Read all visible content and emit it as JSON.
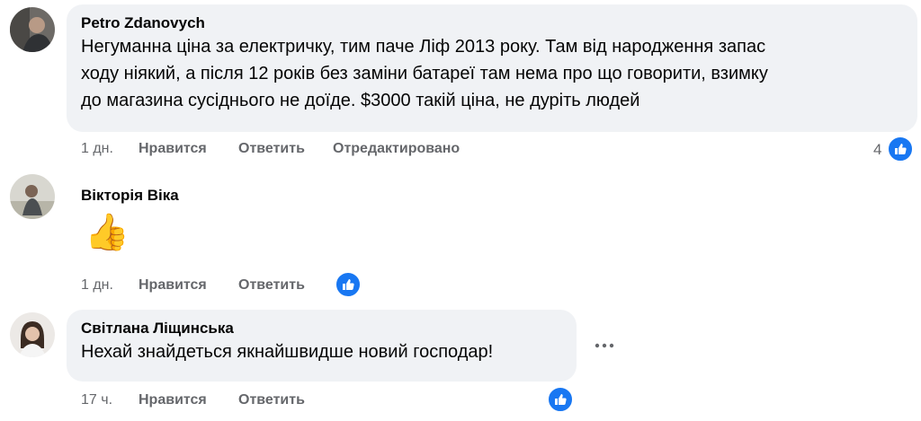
{
  "comments": [
    {
      "author": "Petro Zdanovych",
      "lines": [
        "Негуманна ціна за електричку, тим паче Ліф 2013 року. Там від народження запас",
        "ходу ніякий, а після 12 років без заміни батареї там нема про що говорити, взимку",
        "до магазина сусіднього не доїде. $3000 такій ціна, не дуріть людей"
      ],
      "time": "1 дн.",
      "like_label": "Нравится",
      "reply_label": "Ответить",
      "edited_label": "Отредактировано",
      "reaction_count": "4",
      "reaction_icon": "thumbs-up-icon"
    },
    {
      "author": "Вікторія Віка",
      "emoji": "👍",
      "time": "1 дн.",
      "like_label": "Нравится",
      "reply_label": "Ответить",
      "reaction_icon": "thumbs-up-icon"
    },
    {
      "author": "Світлана Ліщинська",
      "lines": [
        "Нехай знайдеться якнайшвидше новий господар!"
      ],
      "time": "17 ч.",
      "like_label": "Нравится",
      "reply_label": "Ответить",
      "reaction_icon": "thumbs-up-icon",
      "more_icon": "more-options-icon"
    }
  ],
  "colors": {
    "bubble": "#f0f2f5",
    "meta_text": "#65676b",
    "reaction_blue": "#1877f2"
  }
}
